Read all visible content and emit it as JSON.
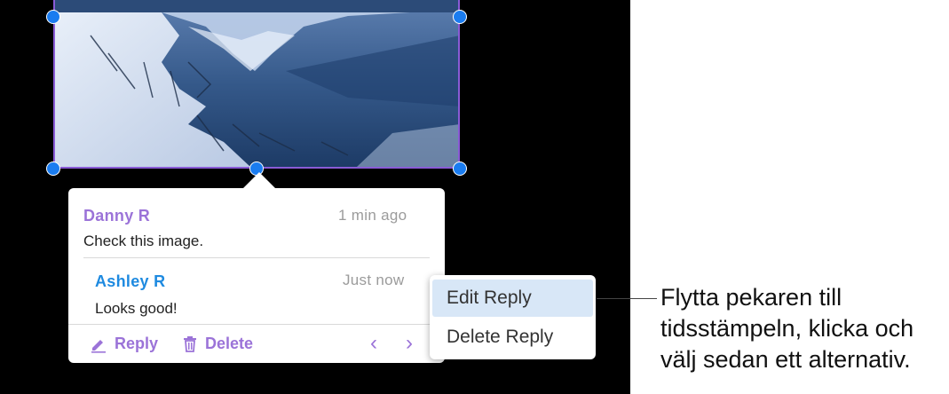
{
  "comments": [
    {
      "author": "Danny R",
      "time": "1 min ago",
      "text": "Check this image."
    },
    {
      "author": "Ashley R",
      "time": "Just now",
      "text": "Looks good!"
    }
  ],
  "actions": {
    "reply": "Reply",
    "delete": "Delete"
  },
  "nav": {
    "prev": "‹",
    "next": "›"
  },
  "context_menu": {
    "items": [
      "Edit Reply",
      "Delete Reply"
    ],
    "selected": "Edit Reply"
  },
  "callout": "Flytta pekaren till tidsstämpeln, klicka och välj sedan ett alternativ.",
  "colors": {
    "handle": "#1a7cf0",
    "author_primary": "#9b73d8",
    "author_reply": "#1e8ae0",
    "menu_highlight": "#d8e7f7"
  },
  "icons": [
    "pencil-icon",
    "trash-icon",
    "chevron-left-icon",
    "chevron-right-icon"
  ]
}
